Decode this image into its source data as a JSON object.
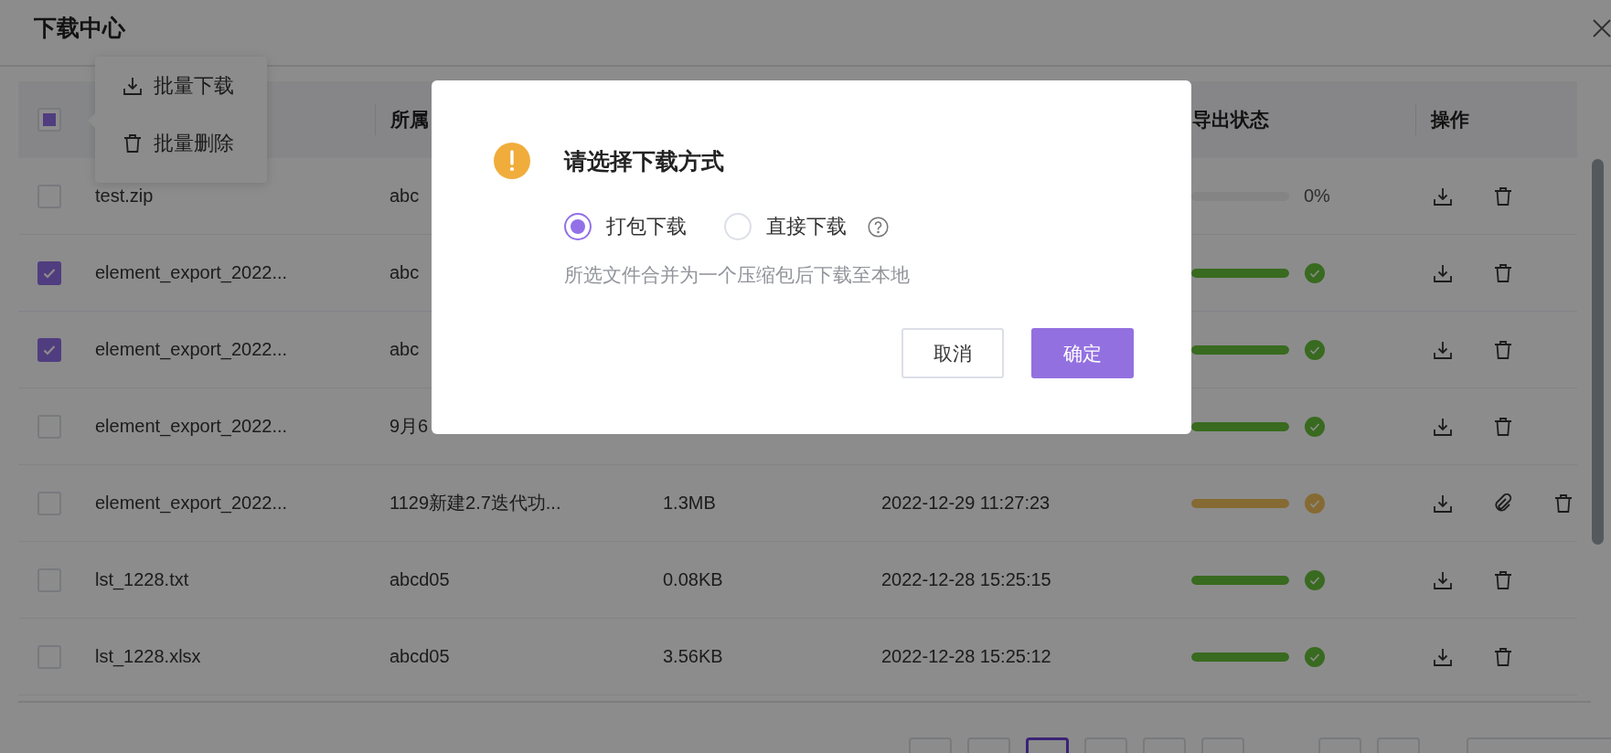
{
  "window": {
    "title": "下载中心"
  },
  "bulk_menu": {
    "items": [
      {
        "kind": "download",
        "label": "批量下载"
      },
      {
        "kind": "delete",
        "label": "批量删除"
      }
    ]
  },
  "table": {
    "header_checkbox": {
      "indeterminate": true
    },
    "columns": [
      {
        "label": "所属"
      },
      {
        "label": "导出状态"
      },
      {
        "label": "操作"
      }
    ],
    "rows": [
      {
        "checked": false,
        "name": "test.zip",
        "project": "abc",
        "status": {
          "kind": "progress",
          "level": 0,
          "reading": "0%"
        },
        "actions": [
          {
            "kind": "download"
          },
          {
            "kind": "delete"
          }
        ]
      },
      {
        "checked": true,
        "name": "element_export_2022...",
        "project": "abc",
        "status": {
          "kind": "success",
          "level": 1
        },
        "actions": [
          {
            "kind": "download"
          },
          {
            "kind": "delete"
          }
        ]
      },
      {
        "checked": true,
        "name": "element_export_2022...",
        "project": "abc",
        "status": {
          "kind": "success",
          "level": 1
        },
        "actions": [
          {
            "kind": "download"
          },
          {
            "kind": "delete"
          }
        ]
      },
      {
        "checked": false,
        "name": "element_export_2022...",
        "project": "9月6",
        "status": {
          "kind": "success",
          "level": 1
        },
        "actions": [
          {
            "kind": "download"
          },
          {
            "kind": "delete"
          }
        ]
      },
      {
        "checked": false,
        "name": "element_export_2022...",
        "project": "1129新建2.7迭代功...",
        "size": "1.3MB",
        "time": "2022-12-29 11:27:23",
        "status": {
          "kind": "warning",
          "level": 1
        },
        "actions": [
          {
            "kind": "download"
          },
          {
            "kind": "attach"
          },
          {
            "kind": "delete"
          }
        ]
      },
      {
        "checked": false,
        "name": "lst_1228.txt",
        "project": "abcd05",
        "size": "0.08KB",
        "time": "2022-12-28 15:25:15",
        "status": {
          "kind": "success",
          "level": 1
        },
        "actions": [
          {
            "kind": "download"
          },
          {
            "kind": "delete"
          }
        ]
      },
      {
        "checked": false,
        "name": "lst_1228.xlsx",
        "project": "abcd05",
        "size": "3.56KB",
        "time": "2022-12-28 15:25:12",
        "status": {
          "kind": "success",
          "level": 1
        },
        "actions": [
          {
            "kind": "download"
          },
          {
            "kind": "delete"
          }
        ]
      }
    ]
  },
  "pagination": {
    "pages": [
      {
        "selected": false
      },
      {
        "selected": false
      },
      {
        "selected": true
      },
      {
        "selected": false
      },
      {
        "selected": false
      },
      {
        "selected": false
      },
      {
        "selected": false
      },
      {
        "selected": false
      }
    ],
    "size_select": true
  },
  "dialog": {
    "title": "请选择下载方式",
    "options": [
      {
        "label": "打包下载",
        "selected": true,
        "help": false
      },
      {
        "label": "直接下载",
        "selected": false,
        "help": true
      }
    ],
    "description": "所选文件合并为一个压缩包后下载至本地",
    "buttons": [
      {
        "kind": "secondary",
        "label": "取消"
      },
      {
        "kind": "primary",
        "label": "确定"
      }
    ]
  }
}
